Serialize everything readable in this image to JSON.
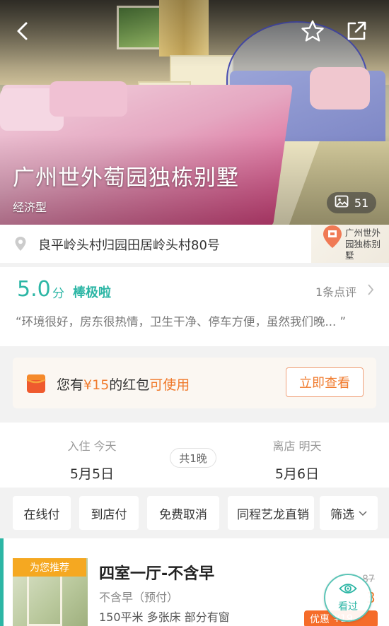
{
  "hero": {
    "title": "广州世外萄园独栋别墅",
    "type": "经济型",
    "photo_count": "51"
  },
  "address": {
    "text": "良平岭头村归园田居岭头村80号",
    "map_label_line1": "广州世外",
    "map_label_line2": "园独栋别墅"
  },
  "rating": {
    "score": "5.0",
    "unit": "分",
    "label": "棒极啦",
    "review_count": "1条点评",
    "quote": "“环境很好，房东很热情，卫生干净、停车方便，虽然我们晚... ”"
  },
  "coupon": {
    "prefix": "您有",
    "amount": "¥15",
    "middle": "的红包",
    "usable": "可使用",
    "button": "立即查看"
  },
  "dates": {
    "checkin_caption": "入住 今天",
    "checkin_date": "5月5日",
    "nights": "共1晚",
    "checkout_caption": "离店 明天",
    "checkout_date": "5月6日"
  },
  "filters": [
    "在线付",
    "到店付",
    "免费取消",
    "同程艺龙直销",
    "筛选"
  ],
  "room": {
    "tag": "为您推荐",
    "name": "四室一厅-不含早",
    "meal": "不含早（预付）",
    "spec": "150平米 多张床 部分有窗",
    "orig_price": "87",
    "price_hint": "3",
    "discount_label": "优惠",
    "discount_amount": "¥19"
  },
  "seen_button": "看过",
  "colors": {
    "accent": "#2cb6a5",
    "coupon_orange": "#f07a2c",
    "tag_yellow": "#f5a821"
  },
  "icons": [
    "back-icon",
    "star-icon",
    "share-icon",
    "photo-icon",
    "location-pin-icon",
    "chevron-right-icon",
    "red-packet-icon",
    "chevron-down-icon",
    "eye-icon"
  ]
}
